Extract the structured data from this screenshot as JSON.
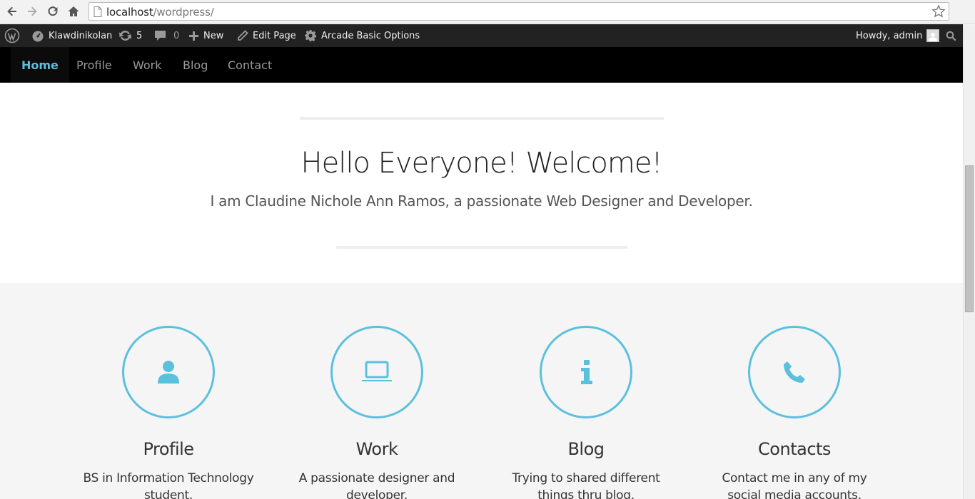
{
  "browser": {
    "url_host": "localhost",
    "url_path": "/wordpress/"
  },
  "admin_bar": {
    "site_name": "Klawdinikolan",
    "updates_count": "5",
    "comments_count": "0",
    "new_label": "New",
    "edit_page_label": "Edit Page",
    "options_label": "Arcade Basic Options",
    "howdy_label": "Howdy, admin"
  },
  "nav": {
    "items": [
      {
        "label": "Home"
      },
      {
        "label": "Profile"
      },
      {
        "label": "Work"
      },
      {
        "label": "Blog"
      },
      {
        "label": "Contact"
      }
    ],
    "accent_color": "#5bc0de"
  },
  "hero": {
    "title": "Hello Everyone! Welcome!",
    "subtitle": "I am Claudine Nichole Ann Ramos, a passionate Web Designer and Developer."
  },
  "features": [
    {
      "icon": "user-icon",
      "title": "Profile",
      "text": "BS in Information Technology student."
    },
    {
      "icon": "laptop-icon",
      "title": "Work",
      "text": "A passionate designer and developer."
    },
    {
      "icon": "info-icon",
      "title": "Blog",
      "text": "Trying to shared different things thru blog."
    },
    {
      "icon": "phone-icon",
      "title": "Contacts",
      "text": "Contact me in any of my social media accounts."
    }
  ]
}
